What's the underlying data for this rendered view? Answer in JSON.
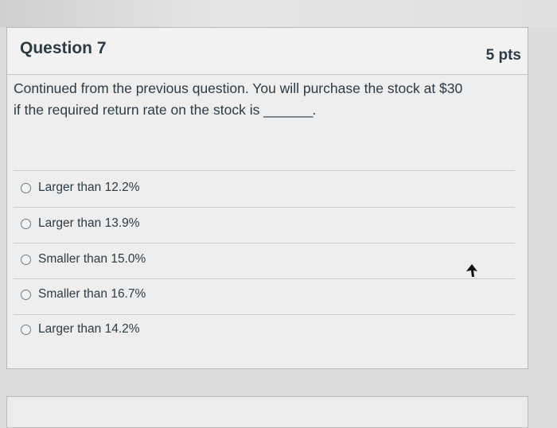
{
  "question": {
    "title": "Question 7",
    "points": "5 pts",
    "text_line1": "Continued from the previous question. You will purchase the stock at $30",
    "text_line2": "if the required return rate on the stock is",
    "blank": "_______."
  },
  "answers": [
    {
      "label": "Larger than 12.2%"
    },
    {
      "label": "Larger than 13.9%"
    },
    {
      "label": "Smaller than 15.0%"
    },
    {
      "label": "Smaller than 16.7%"
    },
    {
      "label": "Larger than 14.2%"
    }
  ],
  "colors": {
    "text": "#2d3b45",
    "card_bg": "#eeeeee",
    "border": "#b9b9b9"
  },
  "icons": {
    "answer_marker": "radio-icon",
    "pointer": "mouse-cursor-icon"
  }
}
